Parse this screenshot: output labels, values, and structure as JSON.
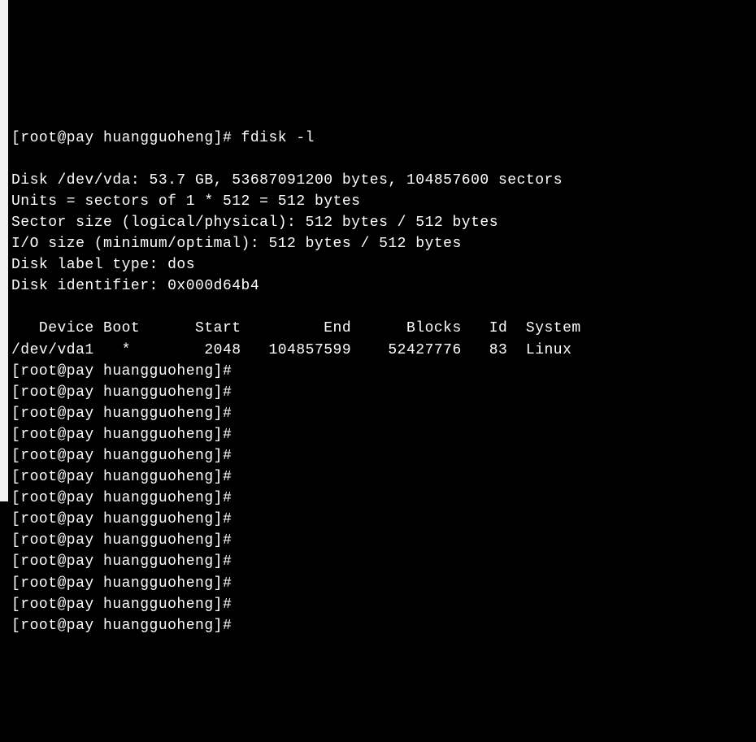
{
  "lines": [
    "[root@pay huangguoheng]# fdisk -l",
    "",
    "Disk /dev/vda: 53.7 GB, 53687091200 bytes, 104857600 sectors",
    "Units = sectors of 1 * 512 = 512 bytes",
    "Sector size (logical/physical): 512 bytes / 512 bytes",
    "I/O size (minimum/optimal): 512 bytes / 512 bytes",
    "Disk label type: dos",
    "Disk identifier: 0x000d64b4",
    "",
    "   Device Boot      Start         End      Blocks   Id  System",
    "/dev/vda1   *        2048   104857599    52427776   83  Linux",
    "[root@pay huangguoheng]# ",
    "[root@pay huangguoheng]# ",
    "[root@pay huangguoheng]# ",
    "[root@pay huangguoheng]# ",
    "[root@pay huangguoheng]# ",
    "[root@pay huangguoheng]# ",
    "[root@pay huangguoheng]# ",
    "[root@pay huangguoheng]# ",
    "[root@pay huangguoheng]# ",
    "[root@pay huangguoheng]# ",
    "[root@pay huangguoheng]# ",
    "[root@pay huangguoheng]# ",
    "[root@pay huangguoheng]# "
  ]
}
